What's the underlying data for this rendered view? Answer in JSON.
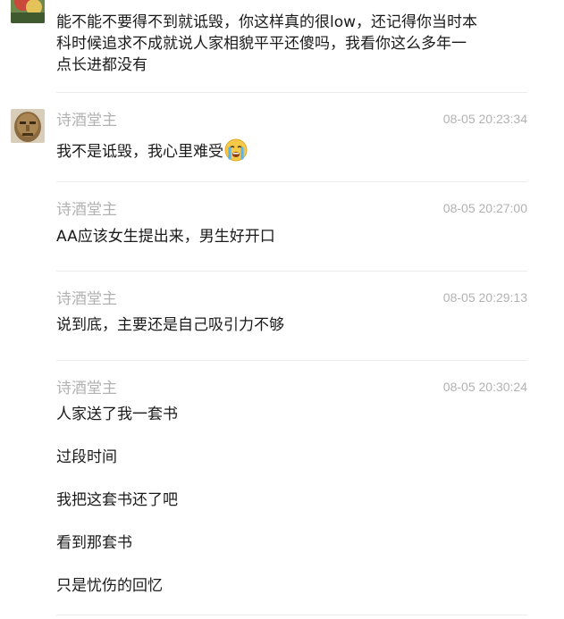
{
  "messages": [
    {
      "sender": "",
      "time": "",
      "lines": [
        "能不能不要得不到就诋毁，你这样真的很low，还记得你当时本",
        "科时候追求不成就说人家相貌平平还傻吗，我看你这么多年一",
        "点长进都没有"
      ]
    },
    {
      "sender": "诗酒堂主",
      "time": "08-05 20:23:34",
      "lines": [
        "我不是诋毁，我心里难受"
      ],
      "emoji": "crying-face-icon"
    },
    {
      "sender": "诗酒堂主",
      "time": "08-05 20:27:00",
      "lines": [
        "AA应该女生提出来，男生好开口"
      ]
    },
    {
      "sender": "诗酒堂主",
      "time": "08-05 20:29:13",
      "lines": [
        "说到底，主要还是自己吸引力不够"
      ]
    },
    {
      "sender": "诗酒堂主",
      "time": "08-05 20:30:24",
      "lines": [
        "人家送了我一套书",
        "过段时间",
        "我把这套书还了吧",
        "看到那套书",
        "只是忧伤的回忆"
      ]
    }
  ],
  "colors": {
    "meta_text": "#b2b2b2",
    "body_text": "#1a1a1a",
    "divider": "#ececec",
    "background": "#ffffff"
  }
}
